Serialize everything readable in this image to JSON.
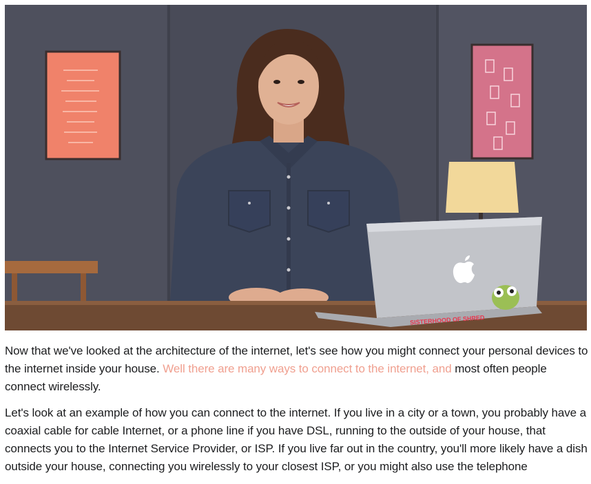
{
  "video": {
    "laptop_sticker": "SISTERHOOD OF SHRED"
  },
  "transcript": {
    "p1_before": "Now that we've looked at the architecture of the internet, let's see how you might connect your personal devices to the internet inside your house. ",
    "p1_highlight": "Well there are many ways to connect to the internet, and",
    "p1_after": " most often people connect wirelessly.",
    "p2": "Let's look at an example of how you can connect to the internet. If you live in a city or a town, you probably have a coaxial cable for cable Internet, or a phone line if you have DSL, running to the outside of your house, that connects you to the Internet Service Provider, or ISP. If you live far out in the country, you'll more likely have a dish outside your house, connecting you wirelessly to your closest ISP, or you might also use the telephone"
  },
  "colors": {
    "highlight": "#f0a090",
    "wall": "#4d4f5c",
    "desk": "#6e4a33",
    "shirt": "#3a4258"
  }
}
